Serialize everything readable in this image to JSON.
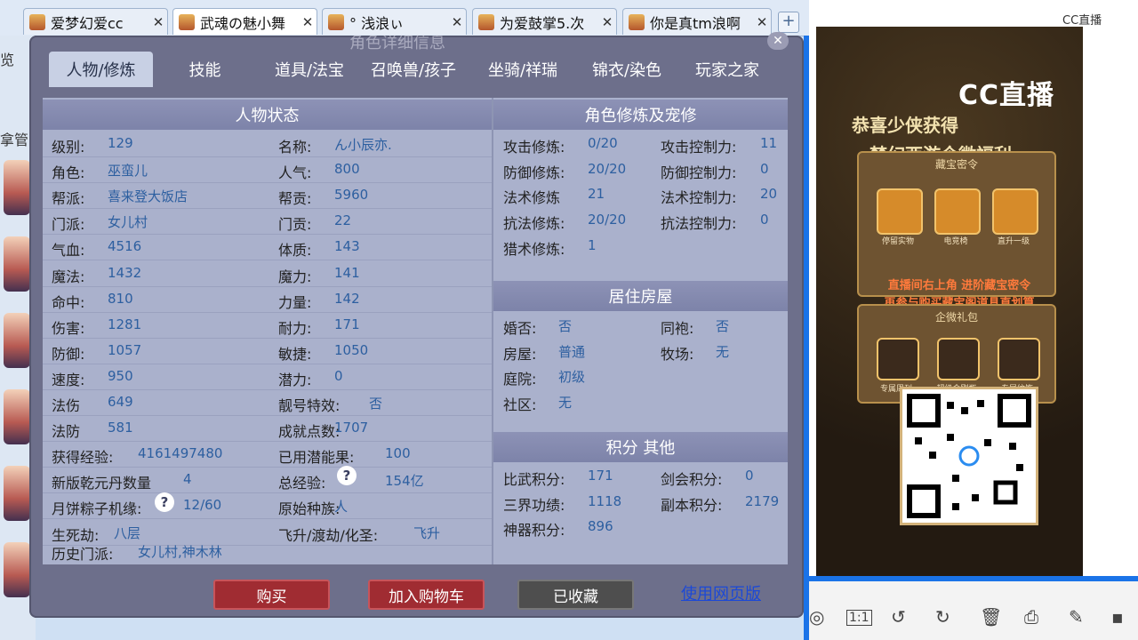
{
  "browser_tabs": [
    {
      "label": "爱梦幻爱cc"
    },
    {
      "label": "武魂の魅小舞"
    },
    {
      "label": "°  浅浪ぃ"
    },
    {
      "label": "为爱鼓掌5.次"
    },
    {
      "label": "你是真tm浪啊"
    }
  ],
  "sidebar": {
    "text1": "览",
    "text2": "拿管"
  },
  "game": {
    "window_title": "角色详细信息",
    "tabs": [
      "人物/修炼",
      "技能",
      "道具/法宝",
      "召唤兽/孩子",
      "坐骑/祥瑞",
      "锦衣/染色",
      "玩家之家"
    ],
    "status": {
      "title": "人物状态",
      "rows": [
        {
          "k1": "级别:",
          "v1": "129",
          "k2": "名称:",
          "v2": "ん小辰亦."
        },
        {
          "k1": "角色:",
          "v1": "巫蛮儿",
          "k2": "人气:",
          "v2": "800"
        },
        {
          "k1": "帮派:",
          "v1": "喜来登大饭店",
          "k2": "帮贡:",
          "v2": "5960"
        },
        {
          "k1": "门派:",
          "v1": "女儿村",
          "k2": "门贡:",
          "v2": "22"
        },
        {
          "k1": "气血:",
          "v1": "4516",
          "k2": "体质:",
          "v2": "143"
        },
        {
          "k1": "魔法:",
          "v1": "1432",
          "k2": "魔力:",
          "v2": "141"
        },
        {
          "k1": "命中:",
          "v1": "810",
          "k2": "力量:",
          "v2": "142"
        },
        {
          "k1": "伤害:",
          "v1": "1281",
          "k2": "耐力:",
          "v2": "171"
        },
        {
          "k1": "防御:",
          "v1": "1057",
          "k2": "敏捷:",
          "v2": "1050"
        },
        {
          "k1": "速度:",
          "v1": "950",
          "k2": "潜力:",
          "v2": "0"
        },
        {
          "k1": "法伤",
          "v1": "649",
          "k2": "靓号特效:",
          "v2": "否"
        },
        {
          "k1": "法防",
          "v1": "581",
          "k2": "成就点数:",
          "v2": "1707"
        },
        {
          "k1": "获得经验:",
          "v1": "4161497480",
          "k2": "已用潜能果:",
          "v2": "100"
        },
        {
          "k1": "新版乾元丹数量",
          "v1": "4",
          "k2": "总经验:",
          "v2": "154亿"
        },
        {
          "k1": "月饼粽子机缘:",
          "v1": "12/60",
          "k2": "原始种族:",
          "v2": "人"
        },
        {
          "k1": "生死劫:",
          "v1": "八层",
          "k2": "飞升/渡劫/化圣:",
          "v2": "飞升"
        }
      ],
      "history_label": "历史门派:",
      "history_value": "女儿村,神木林"
    },
    "cultivation": {
      "title": "角色修炼及宠修",
      "rows": [
        {
          "k1": "攻击修炼:",
          "v1": "0/20",
          "k2": "攻击控制力:",
          "v2": "11"
        },
        {
          "k1": "防御修炼:",
          "v1": "20/20",
          "k2": "防御控制力:",
          "v2": "0"
        },
        {
          "k1": "法术修炼",
          "v1": "21",
          "k2": "法术控制力:",
          "v2": "20"
        },
        {
          "k1": "抗法修炼:",
          "v1": "20/20",
          "k2": "抗法控制力:",
          "v2": "0"
        },
        {
          "k1": "猎术修炼:",
          "v1": "1",
          "k2": "",
          "v2": ""
        }
      ]
    },
    "housing": {
      "title": "居住房屋",
      "rows": [
        {
          "k1": "婚否:",
          "v1": "否",
          "k2": "同袍:",
          "v2": "否"
        },
        {
          "k1": "房屋:",
          "v1": "普通",
          "k2": "牧场:",
          "v2": "无"
        },
        {
          "k1": "庭院:",
          "v1": "初级",
          "k2": "",
          "v2": ""
        },
        {
          "k1": "社区:",
          "v1": "无",
          "k2": "",
          "v2": ""
        }
      ]
    },
    "points": {
      "title": "积分 其他",
      "rows": [
        {
          "k1": "比武积分:",
          "v1": "171",
          "k2": "剑会积分:",
          "v2": "0"
        },
        {
          "k1": "三界功绩:",
          "v1": "1118",
          "k2": "副本积分:",
          "v2": "2179"
        },
        {
          "k1": "神器积分:",
          "v1": "896",
          "k2": "",
          "v2": ""
        }
      ]
    },
    "buttons": {
      "buy": "购买",
      "add_cart": "加入购物车",
      "saved": "已收藏",
      "web": "使用网页版"
    },
    "help_glyph": "?"
  },
  "stream": {
    "badge": "CC直播",
    "logo": "CC直播",
    "headline1": "恭喜少侠获得",
    "headline2": "梦幻西游企微福利",
    "card1_title": "藏宝密令",
    "card1_items": [
      "停留实物",
      "电竞椅",
      "直升一级"
    ],
    "promo_line1": "直播间右上角 进阶藏宝密令",
    "promo_line2": "再参与购买藏宝阁道具直划算",
    "card2_title": "企微礼包",
    "card2_items": [
      "专属周刊",
      "超级金刚瓶",
      "专属纹饰"
    ]
  },
  "toolbar": {
    "ratio": "1:1"
  },
  "colors": {
    "panel": "#aab1cc",
    "header": "#8189ad",
    "buy": "#a02c32",
    "saved": "#4e4e4e",
    "link": "#1c49d6"
  }
}
